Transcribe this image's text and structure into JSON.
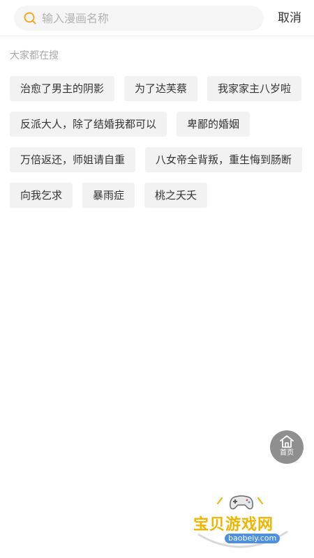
{
  "search": {
    "placeholder": "输入漫画名称",
    "value": "",
    "cancel_label": "取消"
  },
  "hot_searches": {
    "title": "大家都在搜",
    "items": [
      "治愈了男主的阴影",
      "为了达芙蔡",
      "我家家主八岁啦",
      "反派大人，除了结婚我都可以",
      "卑鄙的婚姻",
      "万倍返还，师姐请自重",
      "八女帝全背叛，重生悔到肠断",
      "向我乞求",
      "暴雨症",
      "桃之夭夭"
    ]
  },
  "floating_home": {
    "label": "首页",
    "icon": "home-icon"
  },
  "watermark": {
    "name": "宝贝游戏网",
    "url": "baobeiy.com"
  },
  "colors": {
    "accent": "#f5a623",
    "tag_bg": "#f2f2f2",
    "search_bg": "#f5f5f5",
    "muted_text": "#a8a8a8"
  }
}
